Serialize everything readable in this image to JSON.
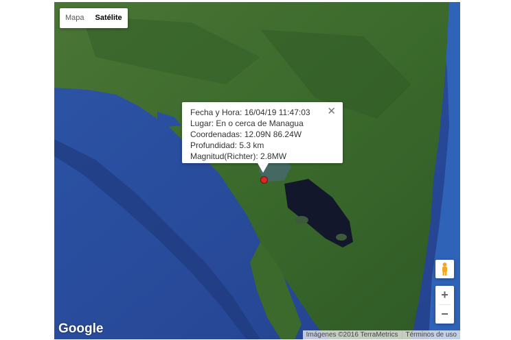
{
  "map_type_control": {
    "options": [
      "Mapa",
      "Satélite"
    ],
    "selected": "Satélite"
  },
  "info_window": {
    "lines": [
      "Fecha y Hora: 16/04/19 11:47:03",
      "Lugar: En o cerca de Managua",
      "Coordenadas: 12.09N 86.24W",
      "Profundidad: 5.3 km",
      "Magnitud(Richter): 2.8MW"
    ],
    "close_icon": "close-icon"
  },
  "marker": {
    "icon": "map-pin-icon",
    "color": "#d62828"
  },
  "controls": {
    "pegman_icon": "pegman-icon",
    "zoom_in": "+",
    "zoom_out": "−"
  },
  "branding": {
    "logo": "Google",
    "imagery_credit": "Imágenes ©2016 TerraMetrics",
    "terms": "Términos de uso"
  },
  "colors": {
    "ocean": "#2a4fa0",
    "land": "#3f6a2e",
    "lake": "#13172b",
    "marker": "#d62828"
  }
}
